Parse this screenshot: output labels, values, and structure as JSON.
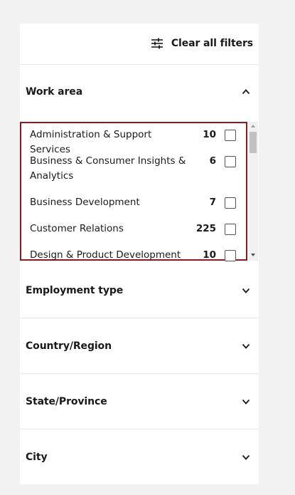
{
  "clear_filters": {
    "label": "Clear all filters",
    "icon": "sliders-icon"
  },
  "sections": [
    {
      "title": "Work area",
      "expanded": true
    },
    {
      "title": "Employment type",
      "expanded": false
    },
    {
      "title": "Country/Region",
      "expanded": false
    },
    {
      "title": "State/Province",
      "expanded": false
    },
    {
      "title": "City",
      "expanded": false
    }
  ],
  "work_area_options": [
    {
      "label": "Administration & Support Services",
      "count": "10",
      "checked": false
    },
    {
      "label": "Business & Consumer Insights & Analytics",
      "count": "6",
      "checked": false
    },
    {
      "label": "Business Development",
      "count": "7",
      "checked": false
    },
    {
      "label": "Customer Relations",
      "count": "225",
      "checked": false
    },
    {
      "label": "Design & Product Development",
      "count": "10",
      "checked": false
    }
  ],
  "colors": {
    "highlight_border": "#8b1a1a",
    "panel_bg": "#ffffff",
    "page_bg": "#f2f2f2"
  }
}
